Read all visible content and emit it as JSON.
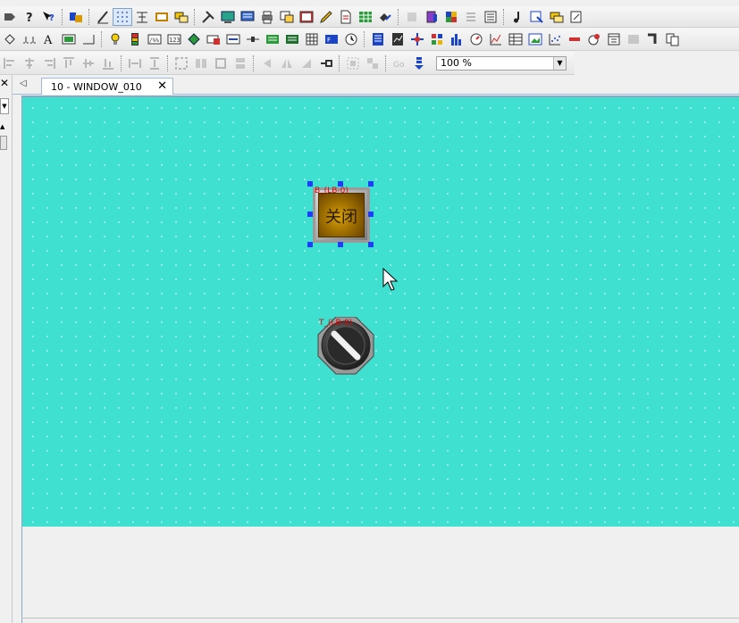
{
  "toolbars": {
    "row1_icons": [
      "tag-icon",
      "help-icon",
      "context-help-icon",
      "find-replace-icon",
      "line-icon",
      "grid-icon",
      "align-icon",
      "rect-icon",
      "overlap-icon",
      "tools-icon",
      "screen-icon",
      "screen2-icon",
      "print-icon",
      "window-icon",
      "picture-icon",
      "pen-icon",
      "doc-icon",
      "table-icon",
      "link-icon",
      "disabled-icon",
      "book-icon",
      "cube-icon",
      "list-icon",
      "list2-icon",
      "music-icon",
      "page-icon",
      "chat-icon",
      "note-icon"
    ],
    "row2_icons": [
      "shape-icon",
      "dotted-line-icon",
      "text-icon",
      "bitmap-icon",
      "frame-icon",
      "lamp-icon",
      "meter-icon",
      "data-icon",
      "number-icon",
      "gem-icon",
      "toggle-icon",
      "input-icon",
      "slider-icon",
      "keypad-icon",
      "chart-icon",
      "grid2-icon",
      "ascii-icon",
      "clock-icon",
      "report-icon",
      "trend-icon",
      "move-icon",
      "alarm-icon",
      "bar-chart-icon",
      "gauge-icon",
      "xy-icon",
      "table2-icon",
      "image-icon",
      "scatter-icon",
      "stop-icon",
      "record-icon",
      "calendar-icon",
      "disabled2-icon",
      "pipe-icon",
      "copy-icon"
    ],
    "row3_icons": [
      "align-left-icon",
      "align-center-icon",
      "align-right-icon",
      "align-top-icon",
      "align-middle-icon",
      "align-bottom-icon",
      "space-h-icon",
      "space-v-icon",
      "size-icon",
      "make-same-icon",
      "arrow-left-icon",
      "flip-icon",
      "rotate-icon",
      "pin-icon",
      "group-icon",
      "ungroup-icon",
      "go-icon",
      "layer-icon"
    ],
    "zoom_value": "100 %"
  },
  "tabs": {
    "active_tab": "10 - WINDOW_010"
  },
  "objects": {
    "button_label": "关闭",
    "button_address": "B_(LB-0)",
    "switch_address": "T_(LB-0)"
  },
  "colors": {
    "canvas_bg": "#40e0d0",
    "selection_handle": "#1f3cff",
    "address_text": "#e00000"
  }
}
